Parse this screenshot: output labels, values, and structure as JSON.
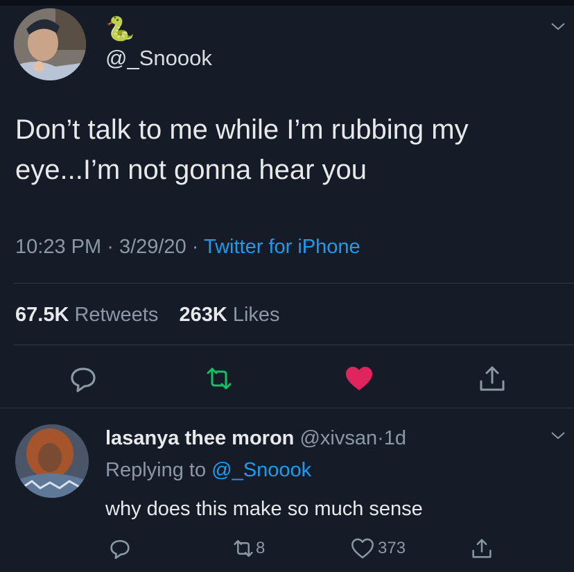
{
  "tweet": {
    "emoji": "🐍",
    "handle": "@_Snoook",
    "text": "Don’t talk to me while I’m rubbing my eye...I’m not gonna hear you",
    "time": "10:23 PM",
    "date": "3/29/20",
    "separator": "·",
    "source": "Twitter for iPhone",
    "retweet_count": "67.5K",
    "retweet_label": "Retweets",
    "like_count": "263K",
    "like_label": "Likes",
    "liked": true
  },
  "reply": {
    "name": "lasanya thee moron",
    "handle": "@xivsan",
    "age": "1d",
    "replying_prefix": "Replying to",
    "replying_to": "@_Snoook",
    "text": "why does this make so much sense",
    "retweets": "8",
    "likes": "373"
  },
  "colors": {
    "background": "#151c27",
    "link": "#1d9bf0",
    "retweet_green": "#17bf63",
    "like_red": "#e0245e",
    "muted": "#8b98a5"
  },
  "icons": {
    "reply": "reply-icon",
    "retweet": "retweet-icon",
    "like": "heart-icon",
    "share": "share-icon",
    "menu": "chevron-down-icon"
  }
}
